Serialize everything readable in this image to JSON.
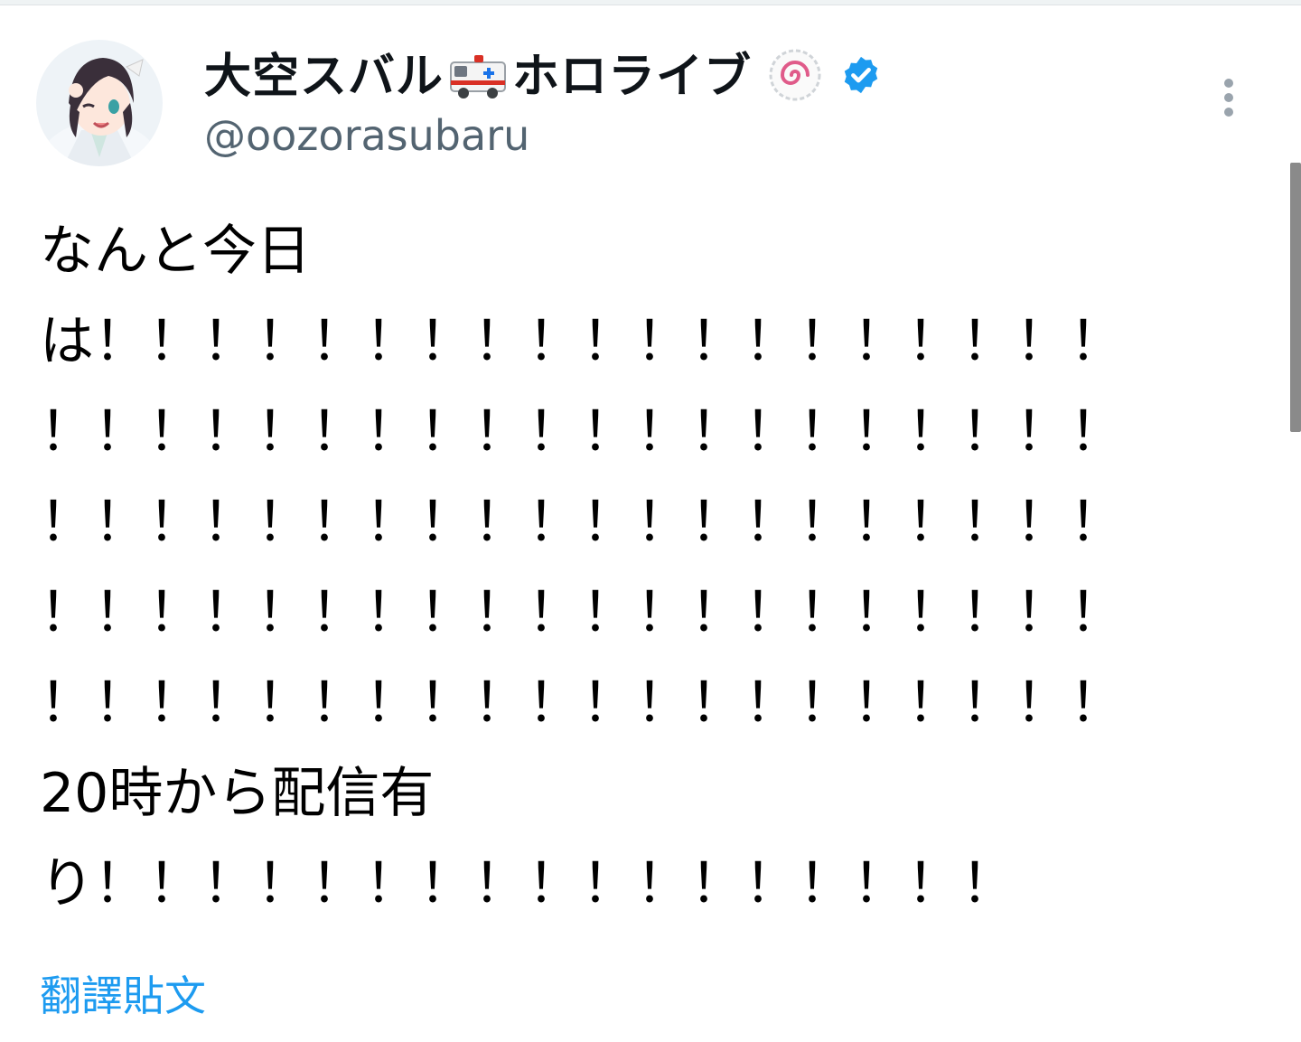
{
  "tweet": {
    "author": {
      "display_name_part1": "大空スバル",
      "display_name_part2": "ホロライブ",
      "handle": "@oozorasubaru",
      "ambulance_icon": "ambulance-emoji",
      "naruto_icon": "naruto-fishcake-emoji",
      "verified_icon": "verified-badge-icon",
      "verified_color": "#1d9bf0"
    },
    "more_icon": "more-vertical-icon",
    "body_lines": [
      "なんと今日",
      "は！！！！！！！！！！！！！！！！！！！",
      "！！！！！！！！！！！！！！！！！！！！",
      "！！！！！！！！！！！！！！！！！！！！",
      "！！！！！！！！！！！！！！！！！！！！",
      "！！！！！！！！！！！！！！！！！！！！",
      "20時から配信有",
      "り！！！！！！！！！！！！！！！！！"
    ],
    "translate_label": "翻譯貼文",
    "link_color": "#1d9bf0"
  }
}
